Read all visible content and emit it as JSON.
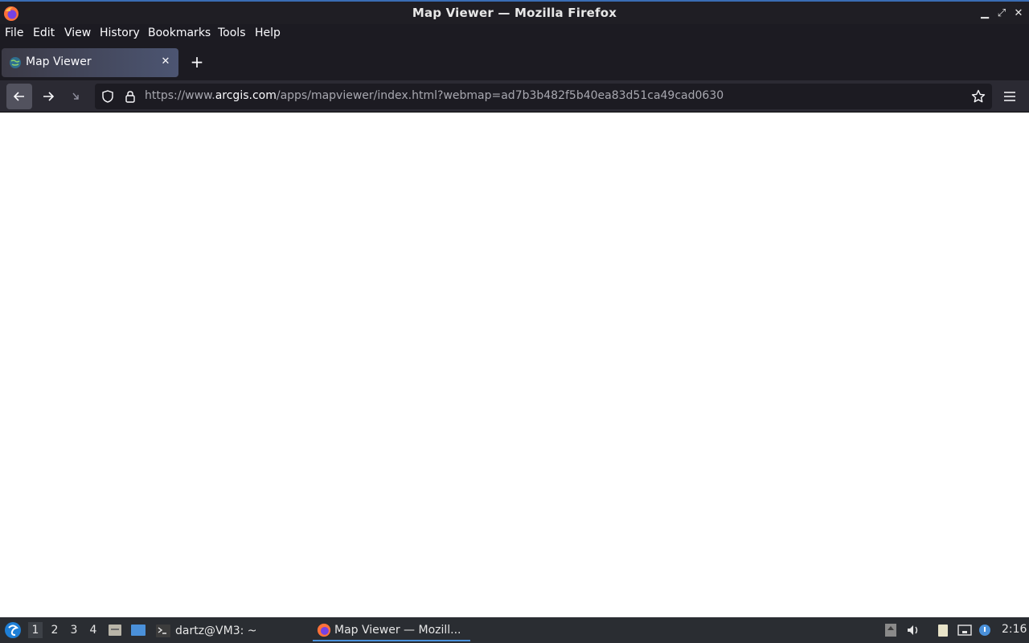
{
  "window": {
    "title": "Map Viewer — Mozilla Firefox"
  },
  "menubar": {
    "items": [
      "File",
      "Edit",
      "View",
      "History",
      "Bookmarks",
      "Tools",
      "Help"
    ]
  },
  "tabs": [
    {
      "title": "Map Viewer"
    }
  ],
  "urlbar": {
    "prefix": "https://www.",
    "host": "arcgis.com",
    "path": "/apps/mapviewer/index.html?webmap=ad7b3b482f5b40ea83d51ca49cad0630"
  },
  "taskbar": {
    "workspaces": [
      "1",
      "2",
      "3",
      "4"
    ],
    "tasks": [
      {
        "label": "dartz@VM3: ~",
        "icon": "terminal-icon"
      },
      {
        "label": "Map Viewer — Mozill...",
        "icon": "firefox-icon"
      }
    ],
    "clock": "2:16"
  },
  "colors": {
    "accent": "#4a90d9",
    "chrome_dark": "#1c1b22",
    "toolbar": "#2b2a33"
  }
}
